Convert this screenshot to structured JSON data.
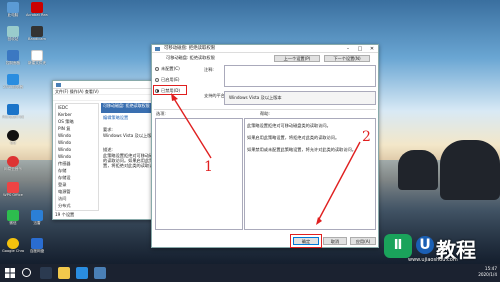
{
  "desktop_icons": [
    {
      "label": "此电脑"
    },
    {
      "label": "Acrobat Reader"
    },
    {
      "label": "回收站"
    },
    {
      "label": "Bandicam"
    },
    {
      "label": "控制面板"
    },
    {
      "label": "Microsoft Edge"
    },
    {
      "label": "2345浏览器"
    },
    {
      "label": "QQ"
    },
    {
      "label": "网易云音乐"
    },
    {
      "label": "WPS Office"
    },
    {
      "label": "微信"
    },
    {
      "label": "迅雷"
    },
    {
      "label": "Google Chrome"
    },
    {
      "label": "酷狗音乐"
    },
    {
      "label": "百度网盘"
    },
    {
      "label": "新建文件夹"
    },
    {
      "label": "小白一键重装"
    },
    {
      "label": "Microsoft Word"
    }
  ],
  "gpedit": {
    "menu": [
      "文件(F)",
      "操作(A)",
      "查看(V)"
    ],
    "tree_items": [
      "IEDC",
      "Kerber",
      "OS 策略",
      "PIN 复",
      "Windo",
      "Windo",
      "Windo",
      "Windo",
      "传感器",
      "存储",
      "存储设",
      "登录",
      "电源管",
      "访问",
      "分布式"
    ],
    "desc_title": "可移动磁盘: 拒绝读取权限",
    "desc_link": "编辑策略设置",
    "req_label": "要求:",
    "req_text": "Windows Vista 及以上版本",
    "desc_label": "描述:",
    "desc_text": "此策略设置拒绝对可移动磁盘类的读取访问。如果启用此策略设置，将拒绝对此类的读取访问。",
    "status": "19 个设置",
    "tabs": [
      "扩展",
      "标准"
    ]
  },
  "dialog": {
    "title": "可移动磁盘: 拒绝读取权限",
    "header_title": "可移动磁盘: 拒绝读取权限",
    "prev_button": "上一个设置(P)",
    "next_button": "下一个设置(N)",
    "options": [
      {
        "label": "未配置(C)",
        "checked": false
      },
      {
        "label": "已启用(E)",
        "checked": false
      },
      {
        "label": "已禁用(D)",
        "checked": true
      }
    ],
    "comment_label": "注释:",
    "supported_label": "支持的平台:",
    "supported_value": "Windows Vista 及以上版本",
    "options_label": "选项:",
    "help_label": "帮助:",
    "help_lines": [
      "此策略设置拒绝对可移动磁盘类的读取访问。",
      "如果启用此策略设置，将拒绝对此类的读取访问。",
      "如果禁用或未配置此策略设置，将允许对此类的读取访问。"
    ],
    "ok_button": "确定",
    "cancel_button": "取消",
    "apply_button": "应用(A)"
  },
  "annotations": {
    "num1": "1",
    "num2": "2",
    "color": "#e02020"
  },
  "taskbar": {
    "time": "15:47",
    "date": "2020/1/4"
  },
  "watermark": {
    "logo_char": "Ⅱ",
    "u_char": "U",
    "brand": "教程",
    "url": "www.ujiaoshou.com"
  }
}
